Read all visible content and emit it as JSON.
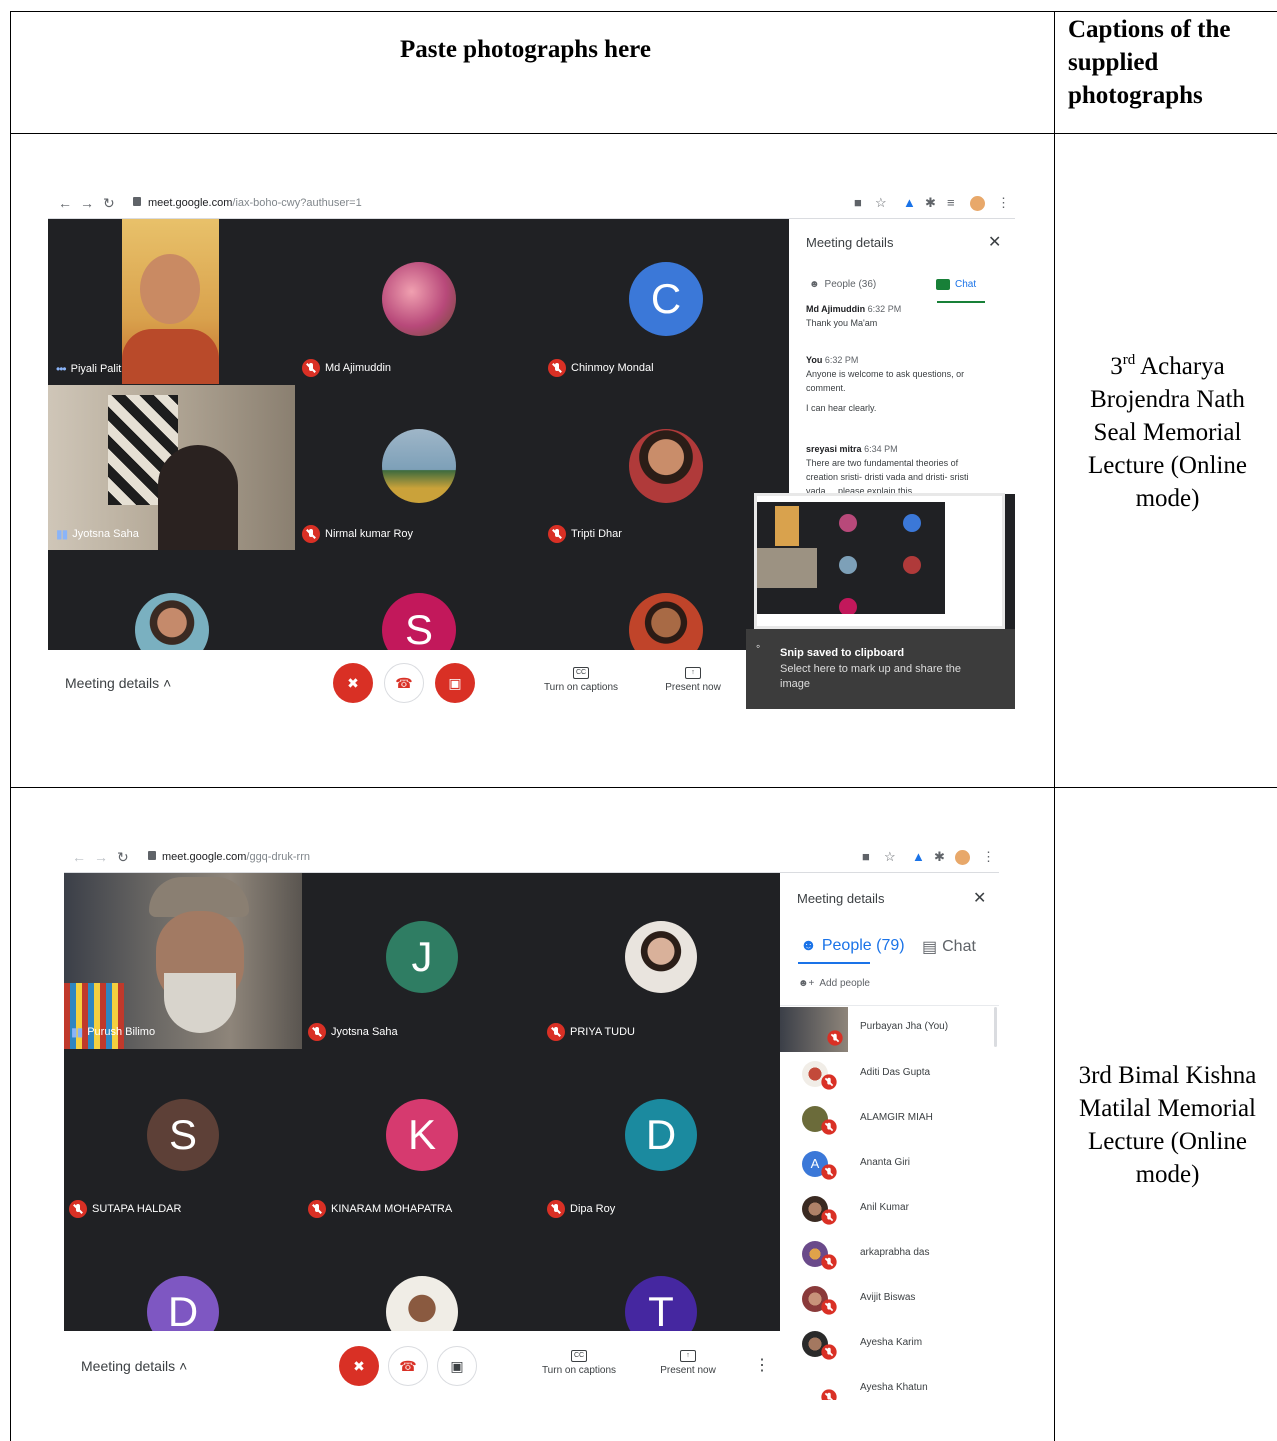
{
  "table": {
    "header_photos": "Paste photographs here",
    "header_captions": [
      "Captions of the",
      "supplied",
      "photographs"
    ]
  },
  "rows": [
    {
      "caption": {
        "prefix": "3",
        "superscript": "rd",
        "lines_first": " Acharya",
        "lines_rest": [
          "Brojendra Nath",
          "Seal Memorial",
          "Lecture (Online",
          "mode)"
        ]
      },
      "screenshot": {
        "url_host": "meet.google.com",
        "url_path": "/iax-boho-cwy?authuser=1",
        "participants": [
          {
            "name": "Piyali Palit"
          },
          {
            "name": "Md Ajimuddin"
          },
          {
            "name": "Chinmoy Mondal",
            "letter": "C"
          },
          {
            "name": "Jyotsna Saha"
          },
          {
            "name": "Nirmal kumar Roy"
          },
          {
            "name": "Tripti Dhar"
          },
          {
            "name": "",
            "letter": "S"
          }
        ],
        "bar": {
          "meeting_details": "Meeting details",
          "captions": "Turn on captions",
          "present": "Present now"
        },
        "panel": {
          "title": "Meeting details",
          "people_tab": "People (36)",
          "chat_tab": "Chat",
          "messages": [
            {
              "sender": "Md Ajimuddin",
              "time": "6:32 PM",
              "lines": [
                "Thank you Ma'am"
              ]
            },
            {
              "sender": "You",
              "time": "6:32 PM",
              "lines": [
                "Anyone is welcome to ask questions, or comment.",
                "I can hear clearly."
              ]
            },
            {
              "sender": "sreyasi mitra",
              "time": "6:34 PM",
              "lines": [
                "There are two fundamental theories of creation sristi- dristi vada and dristi- sristi vada.... please explain this."
              ]
            }
          ]
        },
        "toast": {
          "title": "Snip saved to clipboard",
          "body": "Select here to mark up and share the image"
        }
      }
    },
    {
      "caption": {
        "lines": [
          "3rd Bimal Kishna",
          "Matilal Memorial",
          "Lecture (Online",
          "mode)"
        ]
      },
      "screenshot": {
        "url_host": "meet.google.com",
        "url_path": "/ggq-druk-rrn",
        "participants": [
          {
            "name": "Purush Bilimo"
          },
          {
            "name": "Jyotsna Saha",
            "letter": "J"
          },
          {
            "name": "PRIYA TUDU"
          },
          {
            "name": "SUTAPA HALDAR",
            "letter": "S"
          },
          {
            "name": "KINARAM MOHAPATRA",
            "letter": "K"
          },
          {
            "name": "Dipa Roy",
            "letter": "D"
          },
          {
            "name": "",
            "letter": "D"
          },
          {
            "name": "",
            "letter": "T"
          }
        ],
        "bar": {
          "meeting_details": "Meeting details",
          "captions": "Turn on captions",
          "present": "Present now"
        },
        "panel": {
          "title": "Meeting details",
          "people_tab": "People (79)",
          "chat_tab": "Chat",
          "add_people": "Add people",
          "people": [
            "Purbayan Jha (You)",
            "Aditi Das Gupta",
            "ALAMGIR MIAH",
            "Ananta Giri",
            "Anil Kumar",
            "arkaprabha das",
            "Avijit Biswas",
            "Ayesha Karim",
            "Ayesha Khatun"
          ],
          "ananta_initial": "A"
        }
      }
    }
  ],
  "colors": {
    "meet_dark": "#202124",
    "mute_red": "#d93025",
    "accent_blue": "#1a73e8",
    "avatar_blue": "#3b78d8",
    "avatar_magenta": "#c2185b",
    "avatar_teal": "#2f7d63",
    "avatar_brown": "#5d4037",
    "avatar_pink": "#d63a6f",
    "avatar_cyan": "#1b8a9f",
    "avatar_purple": "#7e57c2",
    "avatar_indigo": "#4527a0"
  }
}
